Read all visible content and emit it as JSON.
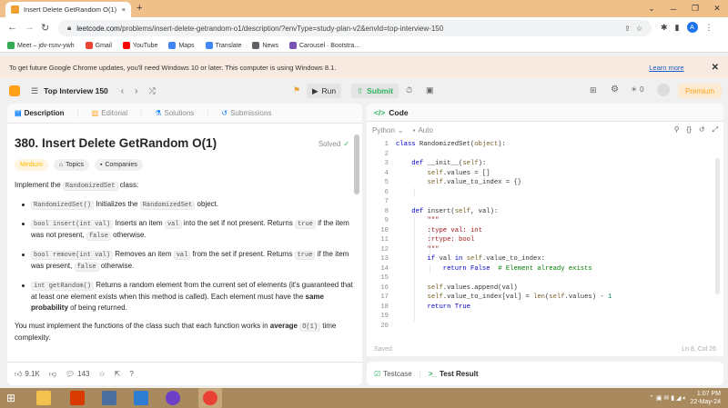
{
  "browser": {
    "tab_title": "Insert Delete GetRandom O(1) -",
    "tab_close": "×",
    "new_tab": "+",
    "url_host": "leetcode.com",
    "url_path": "/problems/insert-delete-getrandom-o1/description/?envType=study-plan-v2&envId=top-interview-150",
    "profile_initial": "A",
    "bookmarks": [
      {
        "label": "Meet – jdv-rsnv-ywh",
        "icon": "meet-icon",
        "color": "#34a853"
      },
      {
        "label": "Gmail",
        "icon": "gmail-icon",
        "color": "#ea4335"
      },
      {
        "label": "YouTube",
        "icon": "youtube-icon",
        "color": "#ff0000"
      },
      {
        "label": "Maps",
        "icon": "maps-icon",
        "color": "#4285f4"
      },
      {
        "label": "Translate",
        "icon": "translate-icon",
        "color": "#4285f4"
      },
      {
        "label": "News",
        "icon": "news-icon",
        "color": "#5f6368"
      },
      {
        "label": "Carousel · Bootstra...",
        "icon": "bootstrap-icon",
        "color": "#7952b3"
      }
    ]
  },
  "infobar": {
    "message": "To get future Google Chrome updates, you'll need Windows 10 or later. This computer is using Windows 8.1.",
    "link": "Learn more",
    "close": "✕"
  },
  "leetcode": {
    "study_plan": "Top Interview 150",
    "run_label": "Run",
    "submit_label": "Submit",
    "streak": "0",
    "premium_label": "Premium",
    "accent": "#ffa116",
    "submit_color": "#2db55d"
  },
  "left_tabs": [
    {
      "label": "Description",
      "icon": "description-icon"
    },
    {
      "label": "Editorial",
      "icon": "editorial-icon"
    },
    {
      "label": "Solutions",
      "icon": "solutions-icon"
    },
    {
      "label": "Submissions",
      "icon": "submissions-icon"
    }
  ],
  "problem": {
    "title": "380. Insert Delete GetRandom O(1)",
    "status": "Solved",
    "difficulty": "Medium",
    "topics": "Topics",
    "companies": "Companies",
    "intro_pre": "Implement the ",
    "intro_code": "RandomizedSet",
    "intro_post": " class:",
    "items": [
      {
        "code": "RandomizedSet()",
        "text": " Initializes the ",
        "code2": "RandomizedSet",
        "text2": " object."
      },
      {
        "code": "bool insert(int val)",
        "text": " Inserts an item ",
        "code2": "val",
        "text2": " into the set if not present. Returns ",
        "code3": "true",
        "text3": " if the item was not present, ",
        "code4": "false",
        "text4": " otherwise."
      },
      {
        "code": "bool remove(int val)",
        "text": " Removes an item ",
        "code2": "val",
        "text2": " from the set if present. Returns ",
        "code3": "true",
        "text3": " if the item was present, ",
        "code4": "false",
        "text4": " otherwise."
      },
      {
        "code": "int getRandom()",
        "text": " Returns a random element from the current set of elements (it's guaranteed that at least one element exists when this method is called). Each element must have the ",
        "bold": "same probability",
        "text2": " of being returned."
      }
    ],
    "outro_pre": "You must implement the functions of the class such that each function works in ",
    "outro_bold": "average",
    "outro_code": "O(1)",
    "outro_post": " time complexity.",
    "likes": "9.1K",
    "comments": "143"
  },
  "code_panel": {
    "title": "Code",
    "language": "Python",
    "mode": "Auto",
    "saved": "Saved",
    "cursor": "Ln 8, Col 26",
    "lines": [
      "class RandomizedSet(object):",
      "",
      "    def __init__(self):",
      "        self.values = []",
      "        self.value_to_index = {}",
      "",
      "",
      "    def insert(self, val):",
      "        \"\"\"",
      "        :type val: int",
      "        :rtype: bool",
      "        \"\"\"",
      "        if val in self.value_to_index:",
      "            return False  # Element already exists",
      "",
      "        self.values.append(val)",
      "        self.value_to_index[val] = len(self.values) - 1",
      "        return True",
      "",
      ""
    ]
  },
  "bottom_tabs": {
    "testcase": "Testcase",
    "test_result": "Test Result"
  },
  "taskbar": {
    "time": "1:07 PM",
    "date": "22-May-24"
  }
}
